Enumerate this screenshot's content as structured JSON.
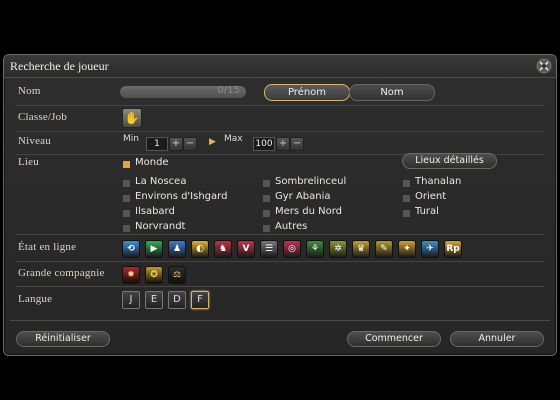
{
  "window": {
    "title": "Recherche de joueur"
  },
  "labels": {
    "nom": "Nom",
    "classe": "Classe/Job",
    "niveau": "Niveau",
    "lieu": "Lieu",
    "etat": "État en ligne",
    "compagnie": "Grande compagnie",
    "langue": "Langue"
  },
  "name_field": {
    "counter": "0/15"
  },
  "name_toggle": {
    "prenom": "Prénom",
    "nom": "Nom",
    "selected": "Prénom"
  },
  "level": {
    "min_label": "Min",
    "min_value": "1",
    "max_label": "Max",
    "max_value": "100"
  },
  "location": {
    "details_button": "Lieux détaillés",
    "world": {
      "label": "Monde",
      "checked": true
    },
    "col1": [
      "La Noscea",
      "Environs d'Ishgard",
      "Ilsabard",
      "Norvrandt"
    ],
    "col2": [
      "Sombrelinceul",
      "Gyr Abania",
      "Mers du Nord",
      "Autres"
    ],
    "col3": [
      "Thanalan",
      "Orient",
      "Tural"
    ]
  },
  "online_status_icons": [
    {
      "name": "status-icon-1",
      "glyph": "⟲",
      "color": "#3a8fe0"
    },
    {
      "name": "status-icon-2",
      "glyph": "▶",
      "color": "#2fae52"
    },
    {
      "name": "status-icon-3",
      "glyph": "♟",
      "color": "#3a7bd5"
    },
    {
      "name": "status-icon-4",
      "glyph": "◐",
      "color": "#e2b328"
    },
    {
      "name": "status-icon-5",
      "glyph": "♞",
      "color": "#c43040"
    },
    {
      "name": "status-icon-6",
      "glyph": "V",
      "color": "#c4304a"
    },
    {
      "name": "status-icon-7",
      "glyph": "☰",
      "color": "#777"
    },
    {
      "name": "status-icon-8",
      "glyph": "◎",
      "color": "#c43050"
    },
    {
      "name": "status-icon-9",
      "glyph": "⚘",
      "color": "#3b8f3a"
    },
    {
      "name": "status-icon-10",
      "glyph": "✲",
      "color": "#8a9a2a"
    },
    {
      "name": "status-icon-11",
      "glyph": "♛",
      "color": "#c7a028"
    },
    {
      "name": "status-icon-12",
      "glyph": "✎",
      "color": "#b59b2a"
    },
    {
      "name": "status-icon-13",
      "glyph": "✦",
      "color": "#cfa02a"
    },
    {
      "name": "status-icon-14",
      "glyph": "✈",
      "color": "#3a8fd0"
    },
    {
      "name": "status-icon-15",
      "glyph": "Rp",
      "color": "#d6a62a"
    }
  ],
  "grand_company_icons": [
    {
      "name": "maelstrom-icon",
      "glyph": "✹",
      "color": "#b3262a"
    },
    {
      "name": "twin-adder-icon",
      "glyph": "✪",
      "color": "#c89a1c"
    },
    {
      "name": "immortal-flames-icon",
      "glyph": "⚖",
      "color": "#2d2d2d"
    }
  ],
  "languages": [
    "J",
    "E",
    "D",
    "F"
  ],
  "selected_language": "F",
  "footer": {
    "reset": "Réinitialiser",
    "start": "Commencer",
    "cancel": "Annuler"
  }
}
